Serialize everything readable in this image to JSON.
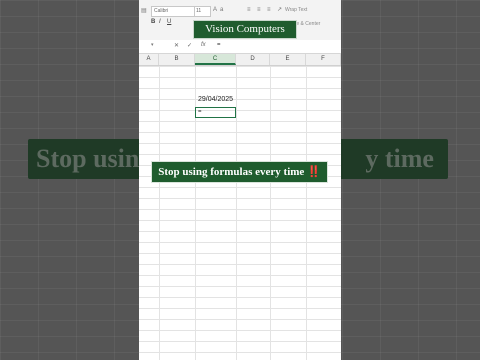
{
  "overlay": {
    "title": "Vision Computers",
    "caption_text": "Stop using formulas every time",
    "caption_emoji": "‼️",
    "background_caption_left": "Stop using",
    "background_caption_right": "y time"
  },
  "ribbon": {
    "font_name": "Calibri",
    "font_size": "11",
    "bold": "B",
    "italic": "I",
    "underline": "U",
    "wrap_text": "Wrap Text",
    "merge_center": "Merge & Center"
  },
  "formula_bar": {
    "name_box": "",
    "cancel": "✕",
    "enter": "✓",
    "fx": "fx",
    "content": "="
  },
  "columns": [
    "A",
    "B",
    "C",
    "D",
    "E",
    "F"
  ],
  "active_column": "C",
  "cells": {
    "c_date": "29/04/2025",
    "c_active": "="
  },
  "colors": {
    "accent": "#1f5c2e",
    "excel_green": "#217346",
    "alert": "#e03a2f"
  }
}
